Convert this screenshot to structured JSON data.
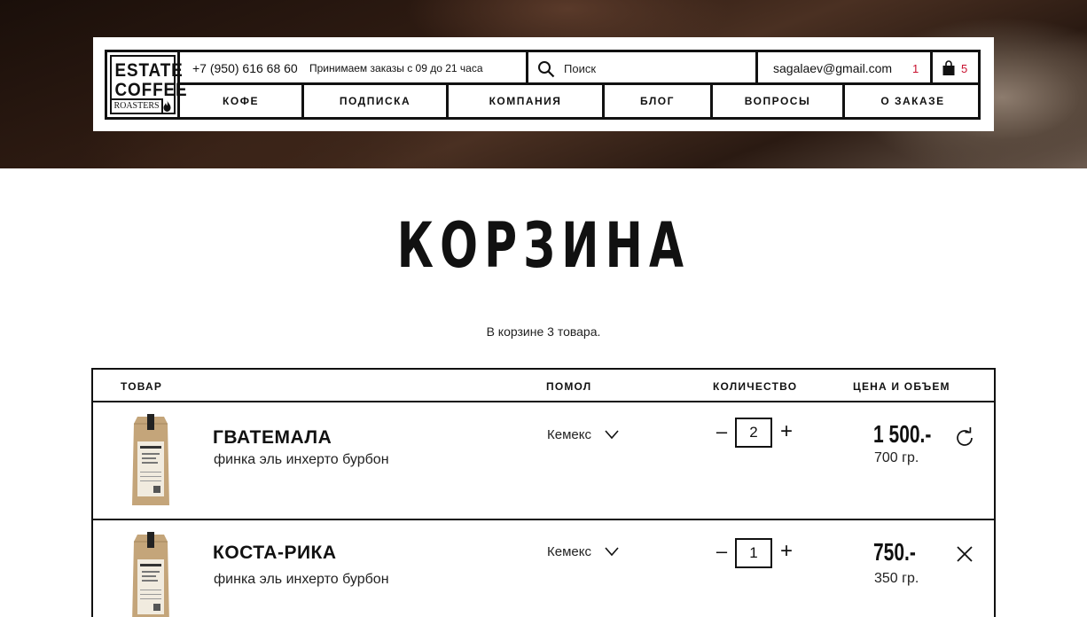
{
  "header": {
    "logo": {
      "line1": "ESTATE",
      "line2": "COFFEE",
      "line3": "ROASTERS"
    },
    "phone": "+7 (950) 616 68 60",
    "hours": "Принимаем заказы с 09 до 21 часа",
    "search": {
      "placeholder": "Поиск"
    },
    "email": "sagalaev@gmail.com",
    "email_count": "1",
    "cart_count": "5",
    "nav": [
      "КОФЕ",
      "ПОДПИСКА",
      "КОМПАНИЯ",
      "БЛОГ",
      "ВОПРОСЫ",
      "О ЗАКАЗЕ"
    ]
  },
  "page": {
    "title": "КОРЗИНА",
    "summary": "В корзине 3 товара."
  },
  "table": {
    "headers": {
      "product": "ТОВАР",
      "grind": "ПОМОЛ",
      "quantity": "КОЛИЧЕСТВО",
      "price": "ЦЕНА И ОБЪЕМ"
    },
    "rows": [
      {
        "name": "ГВАТЕМАЛА",
        "desc": "финка эль инхерто бурбон",
        "grind": "Кемекс",
        "qty": "2",
        "price": "1 500.-",
        "weight": "700 гр.",
        "action_icon": "refresh-icon"
      },
      {
        "name": "КОСТА-РИКА",
        "desc": "финка эль инхерто бурбон",
        "grind": "Кемекс",
        "qty": "1",
        "price": "750.-",
        "weight": "350 гр.",
        "action_icon": "close-icon"
      }
    ]
  },
  "colors": {
    "accent": "#c8102e",
    "text": "#111111"
  }
}
